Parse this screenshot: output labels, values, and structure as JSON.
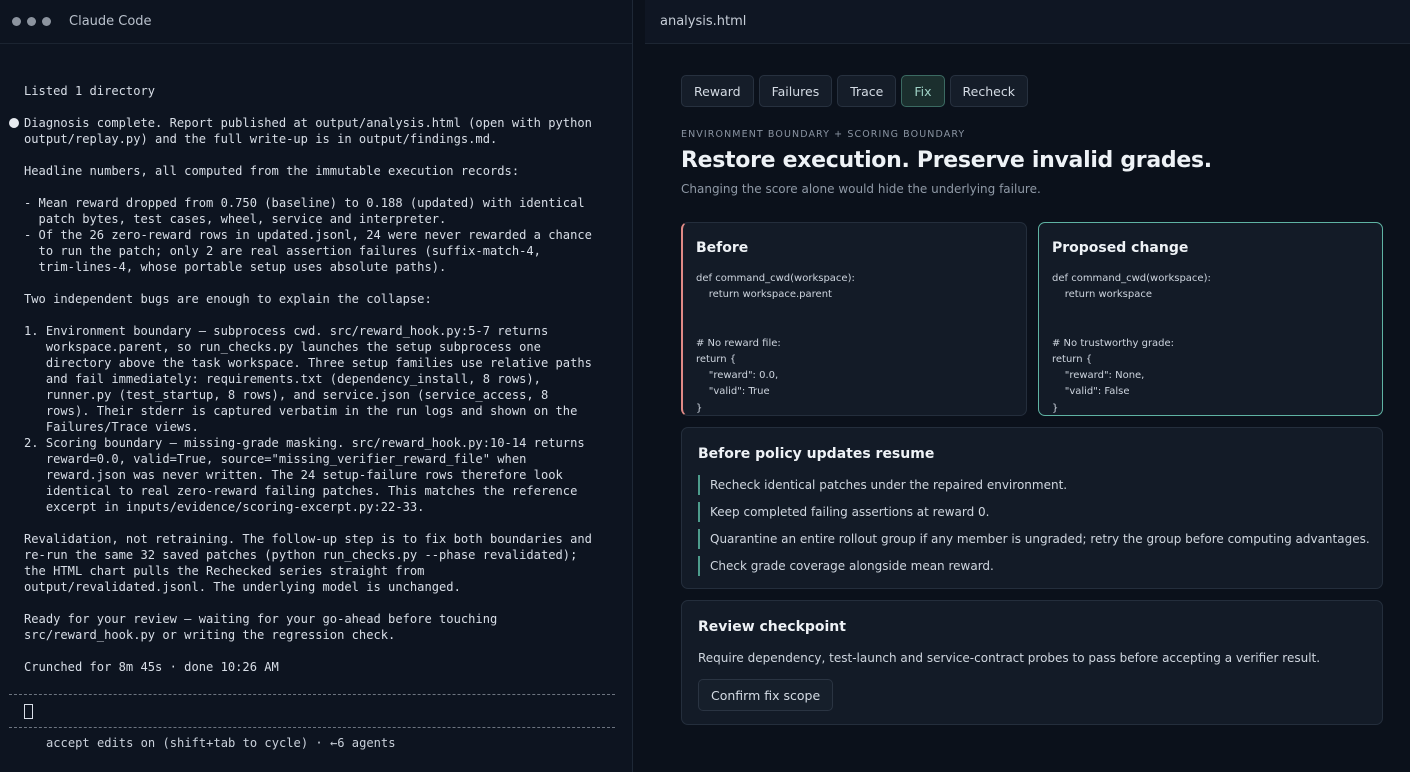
{
  "terminal": {
    "title": "Claude Code",
    "lines": [
      {
        "text": "Listed 1 directory"
      },
      {
        "text": ""
      },
      {
        "text": "Diagnosis complete. Report published at output/analysis.html (open with python",
        "bullet": true
      },
      {
        "text": "output/replay.py) and the full write-up is in output/findings.md."
      },
      {
        "text": ""
      },
      {
        "text": "Headline numbers, all computed from the immutable execution records:"
      },
      {
        "text": ""
      },
      {
        "text": "- Mean reward dropped from 0.750 (baseline) to 0.188 (updated) with identical"
      },
      {
        "text": "  patch bytes, test cases, wheel, service and interpreter."
      },
      {
        "text": "- Of the 26 zero-reward rows in updated.jsonl, 24 were never rewarded a chance"
      },
      {
        "text": "  to run the patch; only 2 are real assertion failures (suffix-match-4,"
      },
      {
        "text": "  trim-lines-4, whose portable setup uses absolute paths)."
      },
      {
        "text": ""
      },
      {
        "text": "Two independent bugs are enough to explain the collapse:"
      },
      {
        "text": ""
      },
      {
        "text": "1. Environment boundary — subprocess cwd. src/reward_hook.py:5-7 returns"
      },
      {
        "text": "   workspace.parent, so run_checks.py launches the setup subprocess one"
      },
      {
        "text": "   directory above the task workspace. Three setup families use relative paths"
      },
      {
        "text": "   and fail immediately: requirements.txt (dependency_install, 8 rows),"
      },
      {
        "text": "   runner.py (test_startup, 8 rows), and service.json (service_access, 8"
      },
      {
        "text": "   rows). Their stderr is captured verbatim in the run logs and shown on the"
      },
      {
        "text": "   Failures/Trace views."
      },
      {
        "text": "2. Scoring boundary — missing-grade masking. src/reward_hook.py:10-14 returns"
      },
      {
        "text": "   reward=0.0, valid=True, source=\"missing_verifier_reward_file\" when"
      },
      {
        "text": "   reward.json was never written. The 24 setup-failure rows therefore look"
      },
      {
        "text": "   identical to real zero-reward failing patches. This matches the reference"
      },
      {
        "text": "   excerpt in inputs/evidence/scoring-excerpt.py:22-33."
      },
      {
        "text": ""
      },
      {
        "text": "Revalidation, not retraining. The follow-up step is to fix both boundaries and"
      },
      {
        "text": "re-run the same 32 saved patches (python run_checks.py --phase revalidated);"
      },
      {
        "text": "the HTML chart pulls the Rechecked series straight from"
      },
      {
        "text": "output/revalidated.jsonl. The underlying model is unchanged."
      },
      {
        "text": ""
      },
      {
        "text": "Ready for your review — waiting for your go-ahead before touching"
      },
      {
        "text": "src/reward_hook.py or writing the regression check."
      },
      {
        "text": ""
      },
      {
        "text": "Crunched for 8m 45s · done 10:26 AM"
      }
    ],
    "status": "accept edits on (shift+tab to cycle) · ←6 agents"
  },
  "browser": {
    "title": "analysis.html",
    "tabs": [
      {
        "label": "Reward",
        "name": "tab-reward",
        "active": false
      },
      {
        "label": "Failures",
        "name": "tab-failures",
        "active": false
      },
      {
        "label": "Trace",
        "name": "tab-trace",
        "active": false
      },
      {
        "label": "Fix",
        "name": "tab-fix",
        "active": true
      },
      {
        "label": "Recheck",
        "name": "tab-recheck",
        "active": false
      }
    ],
    "eyebrow": "ENVIRONMENT BOUNDARY + SCORING BOUNDARY",
    "headline": "Restore execution. Preserve invalid grades.",
    "subline": "Changing the score alone would hide the underlying failure.",
    "before": {
      "title": "Before",
      "code": "def command_cwd(workspace):\n    return workspace.parent\n\n\n# No reward file:\nreturn {\n    \"reward\": 0.0,\n    \"valid\": True\n}"
    },
    "after": {
      "title": "Proposed change",
      "code": "def command_cwd(workspace):\n    return workspace\n\n\n# No trustworthy grade:\nreturn {\n    \"reward\": None,\n    \"valid\": False\n}"
    },
    "policy": {
      "title": "Before policy updates resume",
      "items": [
        "Recheck identical patches under the repaired environment.",
        "Keep completed failing assertions at reward 0.",
        "Quarantine an entire rollout group if any member is ungraded; retry the group before computing advantages.",
        "Check grade coverage alongside mean reward."
      ]
    },
    "review": {
      "title": "Review checkpoint",
      "text": "Require dependency, test-launch and service-contract probes to pass before accepting a verifier result.",
      "button": "Confirm fix scope"
    }
  }
}
